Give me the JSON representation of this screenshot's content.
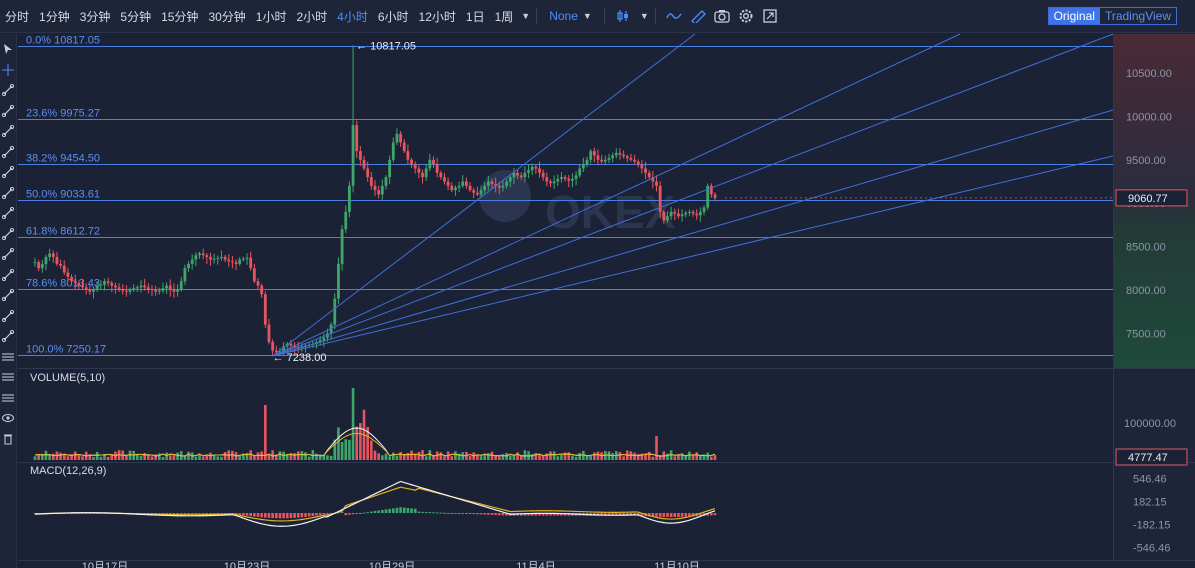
{
  "toolbar": {
    "timeframes": [
      "分时",
      "1分钟",
      "3分钟",
      "5分钟",
      "15分钟",
      "30分钟",
      "1小时",
      "2小时",
      "4小时",
      "6小时",
      "12小时",
      "1日",
      "1周"
    ],
    "active_timeframe": "4小时",
    "study_select": "None",
    "view_original": "Original",
    "view_tradingview": "TradingView"
  },
  "fib": {
    "levels": [
      {
        "label": "0.0% 10817.05",
        "price": 10817.05
      },
      {
        "label": "23.6% 9975.27",
        "price": 9975.27
      },
      {
        "label": "38.2% 9454.50",
        "price": 9454.5
      },
      {
        "label": "50.0% 9033.61",
        "price": 9033.61
      },
      {
        "label": "61.8% 8612.72",
        "price": 8612.72
      },
      {
        "label": "78.6% 8013.43",
        "price": 8013.43
      },
      {
        "label": "100.0% 7250.17",
        "price": 7250.17
      }
    ],
    "high_marker": "← 10817.05",
    "low_marker": "← 7238.00"
  },
  "price_pane": {
    "last_price": "9060.77",
    "watermark": "OKEX"
  },
  "volume_pane": {
    "label": "VOLUME(5,10)",
    "last_value": "4777.47"
  },
  "macd_pane": {
    "label": "MACD(12,26,9)"
  },
  "colors": {
    "background": "#1b2236",
    "up": "#3fa66b",
    "down": "#e8555e",
    "fib_line": "#4a7fe0",
    "accent": "#4b8eff"
  },
  "chart_data": [
    {
      "type": "candlestick",
      "pane": "price",
      "ylim": [
        7100,
        10950
      ],
      "ticks": [
        {
          "label": "7500.00",
          "value": 7500
        },
        {
          "label": "8000.00",
          "value": 8000
        },
        {
          "label": "8500.00",
          "value": 8500
        },
        {
          "label": "9000.00",
          "value": 9000
        },
        {
          "label": "9500.00",
          "value": 9500
        },
        {
          "label": "10000.00",
          "value": 10000
        },
        {
          "label": "10500.00",
          "value": 10500
        }
      ],
      "x_labels": [
        "10月17日",
        "10月23日",
        "10月29日",
        "11月4日",
        "11月10日"
      ],
      "close_path": [
        8320,
        8250,
        8300,
        8380,
        8420,
        8380,
        8300,
        8280,
        8200,
        8150,
        8100,
        8080,
        8050,
        8030,
        8000,
        7980,
        8010,
        8050,
        8060,
        8100,
        8080,
        8050,
        8030,
        8010,
        7990,
        7980,
        8000,
        8020,
        8030,
        8050,
        8030,
        8010,
        8000,
        7980,
        7990,
        8020,
        8050,
        8000,
        7980,
        8000,
        8100,
        8250,
        8300,
        8350,
        8400,
        8420,
        8400,
        8380,
        8350,
        8360,
        8370,
        8380,
        8350,
        8330,
        8320,
        8300,
        8350,
        8360,
        8370,
        8250,
        8100,
        8050,
        7950,
        7600,
        7400,
        7300,
        7280,
        7290,
        7350,
        7380,
        7360,
        7340,
        7330,
        7350,
        7360,
        7370,
        7380,
        7400,
        7420,
        7450,
        7500,
        7600,
        7900,
        8300,
        8700,
        8900,
        9200,
        9900,
        9600,
        9500,
        9400,
        9300,
        9200,
        9150,
        9100,
        9200,
        9300,
        9500,
        9700,
        9800,
        9700,
        9600,
        9500,
        9450,
        9400,
        9350,
        9300,
        9400,
        9500,
        9450,
        9350,
        9300,
        9250,
        9200,
        9150,
        9180,
        9200,
        9250,
        9200,
        9150,
        9120,
        9100,
        9150,
        9200,
        9250,
        9220,
        9200,
        9180,
        9200,
        9250,
        9300,
        9350,
        9320,
        9300,
        9350,
        9380,
        9420,
        9400,
        9350,
        9300,
        9250,
        9230,
        9250,
        9280,
        9300,
        9280,
        9260,
        9280,
        9320,
        9400,
        9450,
        9500,
        9600,
        9550,
        9500,
        9480,
        9500,
        9520,
        9550,
        9580,
        9560,
        9540,
        9520,
        9500,
        9480,
        9450,
        9400,
        9350,
        9300,
        9250,
        9200,
        8900,
        8800,
        8850,
        8900,
        8880,
        8850,
        8870,
        8890,
        8900,
        8880,
        8860,
        8900,
        8950,
        9200,
        9100,
        9060
      ],
      "high": 10817.05,
      "low": 7238.0,
      "last": 9060.77
    },
    {
      "type": "bar",
      "pane": "volume",
      "ticks": [
        {
          "label": "100000.00",
          "value": 100000
        }
      ]
    },
    {
      "type": "histogram",
      "pane": "macd",
      "ticks": [
        {
          "label": "546.46",
          "value": 546.46
        },
        {
          "label": "182.15",
          "value": 182.15
        },
        {
          "label": "-182.15",
          "value": -182.15
        },
        {
          "label": "-546.46",
          "value": -546.46
        }
      ]
    }
  ]
}
